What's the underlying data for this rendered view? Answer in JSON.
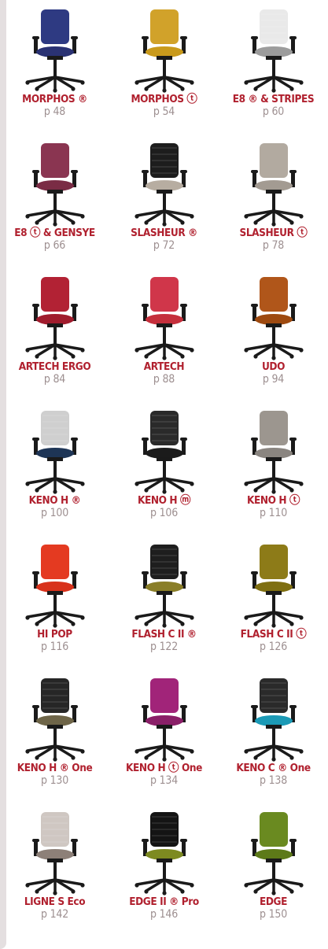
{
  "catalog": {
    "products": [
      {
        "name": "MORPHOS ®",
        "page": "p 48",
        "seat": "#2a3273",
        "back": "#2e3a82",
        "mesh": false
      },
      {
        "name": "MORPHOS ⓣ",
        "page": "p 54",
        "seat": "#c99a1c",
        "back": "#d1a22a",
        "mesh": false
      },
      {
        "name": "E8 ® & STRIPES",
        "page": "p 60",
        "seat": "#9c9c9c",
        "back": "#e9e9e9",
        "mesh": true
      },
      {
        "name": "E8 ⓣ & GENSYE",
        "page": "p 66",
        "seat": "#7a2c45",
        "back": "#8a3551",
        "mesh": false
      },
      {
        "name": "SLASHEUR ®",
        "page": "p 72",
        "seat": "#b7ada1",
        "back": "#1d1d1d",
        "mesh": true
      },
      {
        "name": "SLASHEUR ⓣ",
        "page": "p 78",
        "seat": "#a39b92",
        "back": "#b2aaa0",
        "mesh": false
      },
      {
        "name": "ARTECH ERGO",
        "page": "p 84",
        "seat": "#a01c2d",
        "back": "#b22234",
        "mesh": false
      },
      {
        "name": "ARTECH",
        "page": "p 88",
        "seat": "#c52f3c",
        "back": "#d0364a",
        "mesh": false
      },
      {
        "name": "UDO",
        "page": "p 94",
        "seat": "#9e4a10",
        "back": "#b0561a",
        "mesh": false
      },
      {
        "name": "KENO H ®",
        "page": "p 100",
        "seat": "#1e3556",
        "back": "#cfcfcf",
        "mesh": true
      },
      {
        "name": "KENO H ⓜ",
        "page": "p 106",
        "seat": "#1b1b1b",
        "back": "#2a2a2a",
        "mesh": true
      },
      {
        "name": "KENO H ⓣ",
        "page": "p 110",
        "seat": "#8a8580",
        "back": "#9c968f",
        "mesh": false
      },
      {
        "name": "HI POP",
        "page": "p 116",
        "seat": "#d8321b",
        "back": "#e43a21",
        "mesh": false
      },
      {
        "name": "FLASH C II ®",
        "page": "p 122",
        "seat": "#8a7e28",
        "back": "#1e1e1e",
        "mesh": true
      },
      {
        "name": "FLASH C II ⓣ",
        "page": "p 126",
        "seat": "#7f6f12",
        "back": "#8d7b18",
        "mesh": false
      },
      {
        "name": "KENO H ® One",
        "page": "p 130",
        "seat": "#6e6548",
        "back": "#262626",
        "mesh": true
      },
      {
        "name": "KENO H ⓣ One",
        "page": "p 134",
        "seat": "#8a1f68",
        "back": "#a12479",
        "mesh": false
      },
      {
        "name": "KENO C ® One",
        "page": "p 138",
        "seat": "#1b9ab6",
        "back": "#2a2a2a",
        "mesh": true
      },
      {
        "name": "LIGNE S Eco",
        "page": "p 142",
        "seat": "#8d8078",
        "back": "#cfc7c2",
        "mesh": true
      },
      {
        "name": "EDGE II ® Pro",
        "page": "p 146",
        "seat": "#7d8a20",
        "back": "#141414",
        "mesh": true
      },
      {
        "name": "EDGE",
        "page": "p 150",
        "seat": "#5d7a18",
        "back": "#6a8a20",
        "mesh": false
      }
    ]
  }
}
